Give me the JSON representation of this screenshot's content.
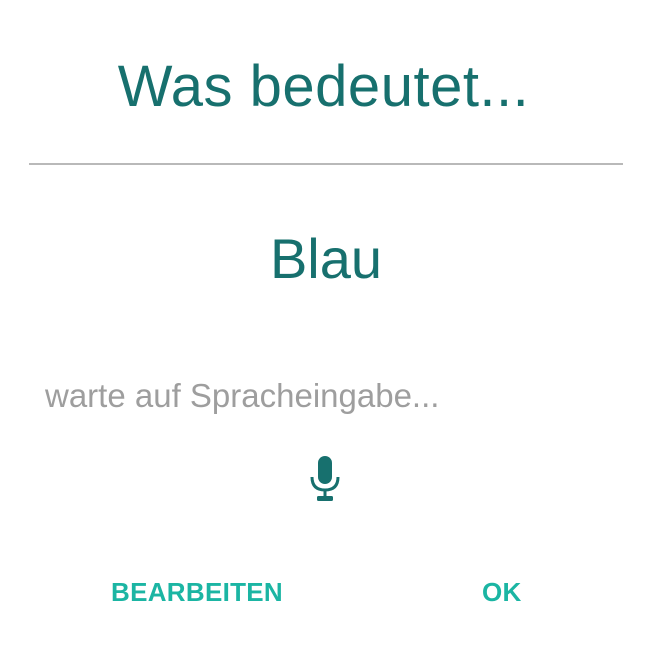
{
  "dialog": {
    "title": "Was bedeutet...",
    "word": "Blau",
    "status": "warte auf Spracheingabe...",
    "mic_icon": "microphone-icon",
    "edit_label": "BEARBEITEN",
    "ok_label": "OK"
  },
  "colors": {
    "primary": "#17706e",
    "accent": "#1bb5a3",
    "hint": "#9e9e9e",
    "divider": "#b9b9b9"
  }
}
